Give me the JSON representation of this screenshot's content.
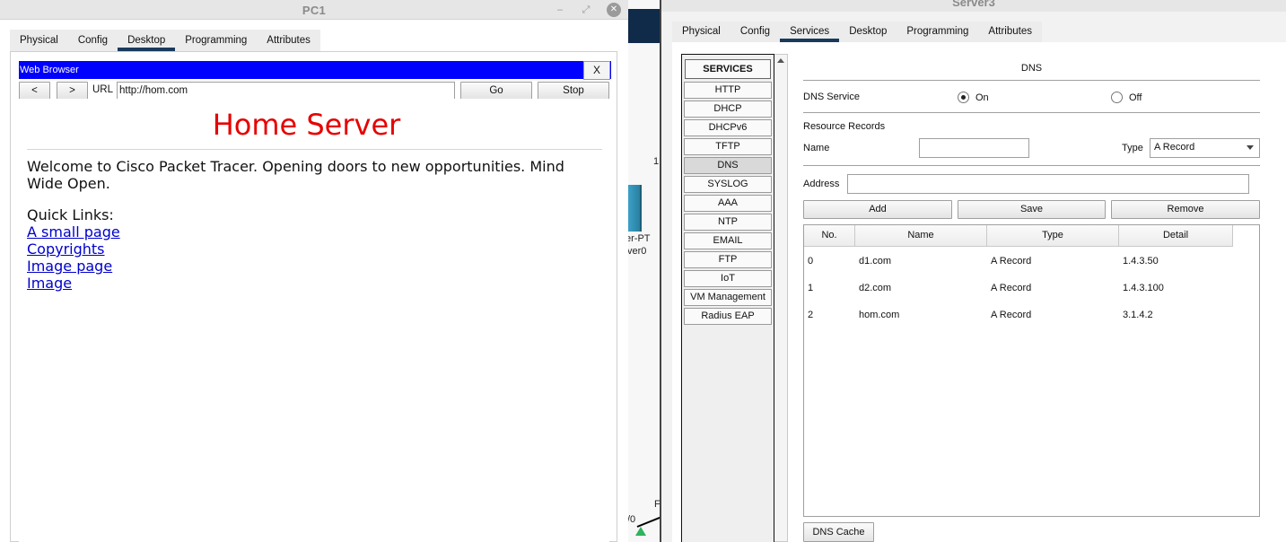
{
  "workspace": {
    "fragments": [
      "1",
      "er-PT",
      "ver0",
      "/0",
      "F"
    ]
  },
  "pc1": {
    "title": "PC1",
    "controls": {
      "minimize": "–",
      "maximize": "⤢",
      "close": "✕"
    },
    "tabs": [
      "Physical",
      "Config",
      "Desktop",
      "Programming",
      "Attributes"
    ],
    "active_tab": "Desktop",
    "browser": {
      "title": "Web Browser",
      "close_label": "X",
      "back_label": "<",
      "forward_label": ">",
      "url_label": "URL",
      "url_value": "http://hom.com",
      "go_label": "Go",
      "stop_label": "Stop",
      "page": {
        "heading": "Home Server",
        "welcome": "Welcome to Cisco Packet Tracer. Opening doors to new opportunities. Mind Wide Open.",
        "quick_links_label": "Quick Links:",
        "links": [
          "A small page",
          "Copyrights",
          "Image page",
          "Image"
        ]
      }
    }
  },
  "server": {
    "title": "Server3",
    "tabs": [
      "Physical",
      "Config",
      "Services",
      "Desktop",
      "Programming",
      "Attributes"
    ],
    "active_tab": "Services",
    "services_header": "SERVICES",
    "services": [
      "HTTP",
      "DHCP",
      "DHCPv6",
      "TFTP",
      "DNS",
      "SYSLOG",
      "AAA",
      "NTP",
      "EMAIL",
      "FTP",
      "IoT",
      "VM Management",
      "Radius EAP"
    ],
    "active_service": "DNS",
    "dns": {
      "title": "DNS",
      "service_label": "DNS Service",
      "on_label": "On",
      "off_label": "Off",
      "service_state": "On",
      "resource_records_label": "Resource Records",
      "name_label": "Name",
      "name_value": "",
      "type_label": "Type",
      "type_value": "A Record",
      "address_label": "Address",
      "address_value": "",
      "add_label": "Add",
      "save_label": "Save",
      "remove_label": "Remove",
      "columns": [
        "No.",
        "Name",
        "Type",
        "Detail"
      ],
      "records": [
        {
          "no": "0",
          "name": "d1.com",
          "type": "A Record",
          "detail": "1.4.3.50"
        },
        {
          "no": "1",
          "name": "d2.com",
          "type": "A Record",
          "detail": "1.4.3.100"
        },
        {
          "no": "2",
          "name": "hom.com",
          "type": "A Record",
          "detail": "3.1.4.2"
        }
      ],
      "cache_label": "DNS Cache"
    }
  }
}
